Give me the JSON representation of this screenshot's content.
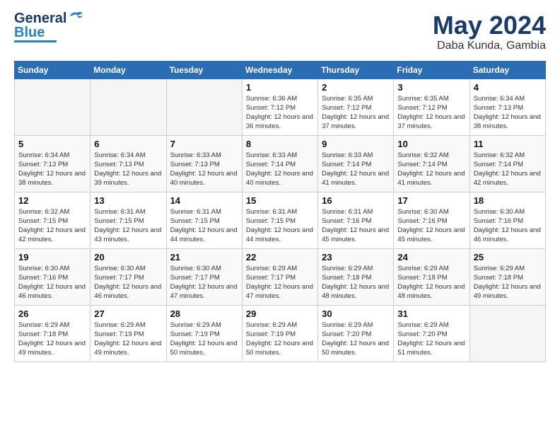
{
  "header": {
    "logo_general": "General",
    "logo_blue": "Blue",
    "month_year": "May 2024",
    "location": "Daba Kunda, Gambia"
  },
  "weekdays": [
    "Sunday",
    "Monday",
    "Tuesday",
    "Wednesday",
    "Thursday",
    "Friday",
    "Saturday"
  ],
  "weeks": [
    [
      {
        "day": "",
        "sunrise": "",
        "sunset": "",
        "daylight": ""
      },
      {
        "day": "",
        "sunrise": "",
        "sunset": "",
        "daylight": ""
      },
      {
        "day": "",
        "sunrise": "",
        "sunset": "",
        "daylight": ""
      },
      {
        "day": "1",
        "sunrise": "Sunrise: 6:36 AM",
        "sunset": "Sunset: 7:12 PM",
        "daylight": "Daylight: 12 hours and 36 minutes."
      },
      {
        "day": "2",
        "sunrise": "Sunrise: 6:35 AM",
        "sunset": "Sunset: 7:12 PM",
        "daylight": "Daylight: 12 hours and 37 minutes."
      },
      {
        "day": "3",
        "sunrise": "Sunrise: 6:35 AM",
        "sunset": "Sunset: 7:12 PM",
        "daylight": "Daylight: 12 hours and 37 minutes."
      },
      {
        "day": "4",
        "sunrise": "Sunrise: 6:34 AM",
        "sunset": "Sunset: 7:13 PM",
        "daylight": "Daylight: 12 hours and 38 minutes."
      }
    ],
    [
      {
        "day": "5",
        "sunrise": "Sunrise: 6:34 AM",
        "sunset": "Sunset: 7:13 PM",
        "daylight": "Daylight: 12 hours and 38 minutes."
      },
      {
        "day": "6",
        "sunrise": "Sunrise: 6:34 AM",
        "sunset": "Sunset: 7:13 PM",
        "daylight": "Daylight: 12 hours and 39 minutes."
      },
      {
        "day": "7",
        "sunrise": "Sunrise: 6:33 AM",
        "sunset": "Sunset: 7:13 PM",
        "daylight": "Daylight: 12 hours and 40 minutes."
      },
      {
        "day": "8",
        "sunrise": "Sunrise: 6:33 AM",
        "sunset": "Sunset: 7:14 PM",
        "daylight": "Daylight: 12 hours and 40 minutes."
      },
      {
        "day": "9",
        "sunrise": "Sunrise: 6:33 AM",
        "sunset": "Sunset: 7:14 PM",
        "daylight": "Daylight: 12 hours and 41 minutes."
      },
      {
        "day": "10",
        "sunrise": "Sunrise: 6:32 AM",
        "sunset": "Sunset: 7:14 PM",
        "daylight": "Daylight: 12 hours and 41 minutes."
      },
      {
        "day": "11",
        "sunrise": "Sunrise: 6:32 AM",
        "sunset": "Sunset: 7:14 PM",
        "daylight": "Daylight: 12 hours and 42 minutes."
      }
    ],
    [
      {
        "day": "12",
        "sunrise": "Sunrise: 6:32 AM",
        "sunset": "Sunset: 7:15 PM",
        "daylight": "Daylight: 12 hours and 42 minutes."
      },
      {
        "day": "13",
        "sunrise": "Sunrise: 6:31 AM",
        "sunset": "Sunset: 7:15 PM",
        "daylight": "Daylight: 12 hours and 43 minutes."
      },
      {
        "day": "14",
        "sunrise": "Sunrise: 6:31 AM",
        "sunset": "Sunset: 7:15 PM",
        "daylight": "Daylight: 12 hours and 44 minutes."
      },
      {
        "day": "15",
        "sunrise": "Sunrise: 6:31 AM",
        "sunset": "Sunset: 7:15 PM",
        "daylight": "Daylight: 12 hours and 44 minutes."
      },
      {
        "day": "16",
        "sunrise": "Sunrise: 6:31 AM",
        "sunset": "Sunset: 7:16 PM",
        "daylight": "Daylight: 12 hours and 45 minutes."
      },
      {
        "day": "17",
        "sunrise": "Sunrise: 6:30 AM",
        "sunset": "Sunset: 7:16 PM",
        "daylight": "Daylight: 12 hours and 45 minutes."
      },
      {
        "day": "18",
        "sunrise": "Sunrise: 6:30 AM",
        "sunset": "Sunset: 7:16 PM",
        "daylight": "Daylight: 12 hours and 46 minutes."
      }
    ],
    [
      {
        "day": "19",
        "sunrise": "Sunrise: 6:30 AM",
        "sunset": "Sunset: 7:16 PM",
        "daylight": "Daylight: 12 hours and 46 minutes."
      },
      {
        "day": "20",
        "sunrise": "Sunrise: 6:30 AM",
        "sunset": "Sunset: 7:17 PM",
        "daylight": "Daylight: 12 hours and 46 minutes."
      },
      {
        "day": "21",
        "sunrise": "Sunrise: 6:30 AM",
        "sunset": "Sunset: 7:17 PM",
        "daylight": "Daylight: 12 hours and 47 minutes."
      },
      {
        "day": "22",
        "sunrise": "Sunrise: 6:29 AM",
        "sunset": "Sunset: 7:17 PM",
        "daylight": "Daylight: 12 hours and 47 minutes."
      },
      {
        "day": "23",
        "sunrise": "Sunrise: 6:29 AM",
        "sunset": "Sunset: 7:18 PM",
        "daylight": "Daylight: 12 hours and 48 minutes."
      },
      {
        "day": "24",
        "sunrise": "Sunrise: 6:29 AM",
        "sunset": "Sunset: 7:18 PM",
        "daylight": "Daylight: 12 hours and 48 minutes."
      },
      {
        "day": "25",
        "sunrise": "Sunrise: 6:29 AM",
        "sunset": "Sunset: 7:18 PM",
        "daylight": "Daylight: 12 hours and 49 minutes."
      }
    ],
    [
      {
        "day": "26",
        "sunrise": "Sunrise: 6:29 AM",
        "sunset": "Sunset: 7:18 PM",
        "daylight": "Daylight: 12 hours and 49 minutes."
      },
      {
        "day": "27",
        "sunrise": "Sunrise: 6:29 AM",
        "sunset": "Sunset: 7:19 PM",
        "daylight": "Daylight: 12 hours and 49 minutes."
      },
      {
        "day": "28",
        "sunrise": "Sunrise: 6:29 AM",
        "sunset": "Sunset: 7:19 PM",
        "daylight": "Daylight: 12 hours and 50 minutes."
      },
      {
        "day": "29",
        "sunrise": "Sunrise: 6:29 AM",
        "sunset": "Sunset: 7:19 PM",
        "daylight": "Daylight: 12 hours and 50 minutes."
      },
      {
        "day": "30",
        "sunrise": "Sunrise: 6:29 AM",
        "sunset": "Sunset: 7:20 PM",
        "daylight": "Daylight: 12 hours and 50 minutes."
      },
      {
        "day": "31",
        "sunrise": "Sunrise: 6:29 AM",
        "sunset": "Sunset: 7:20 PM",
        "daylight": "Daylight: 12 hours and 51 minutes."
      },
      {
        "day": "",
        "sunrise": "",
        "sunset": "",
        "daylight": ""
      }
    ]
  ]
}
